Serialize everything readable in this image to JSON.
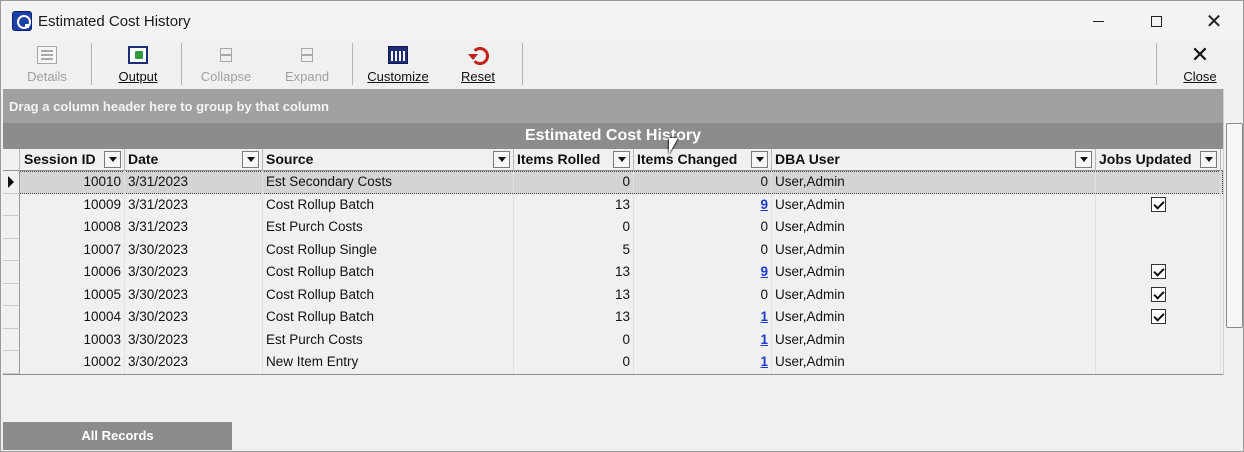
{
  "window": {
    "title": "Estimated Cost History"
  },
  "toolbar": {
    "details": "Details",
    "output": "Output",
    "collapse": "Collapse",
    "expand": "Expand",
    "customize": "Customize",
    "reset": "Reset",
    "close": "Close"
  },
  "grid": {
    "group_hint": "Drag a column header here to group by that column",
    "caption": "Estimated Cost History",
    "columns": [
      "Session ID",
      "Date",
      "Source",
      "Items Rolled",
      "Items Changed",
      "DBA User",
      "Jobs Updated"
    ],
    "rows": [
      {
        "session_id": "10010",
        "date": "3/31/2023",
        "source": "Est Secondary Costs",
        "items_rolled": "0",
        "items_changed": "0",
        "changed_link": false,
        "dba_user": "User,Admin",
        "jobs_updated": false,
        "active": true
      },
      {
        "session_id": "10009",
        "date": "3/31/2023",
        "source": "Cost Rollup Batch",
        "items_rolled": "13",
        "items_changed": "9",
        "changed_link": true,
        "dba_user": "User,Admin",
        "jobs_updated": true,
        "active": false
      },
      {
        "session_id": "10008",
        "date": "3/31/2023",
        "source": "Est Purch Costs",
        "items_rolled": "0",
        "items_changed": "0",
        "changed_link": false,
        "dba_user": "User,Admin",
        "jobs_updated": false,
        "active": false
      },
      {
        "session_id": "10007",
        "date": "3/30/2023",
        "source": "Cost Rollup Single",
        "items_rolled": "5",
        "items_changed": "0",
        "changed_link": false,
        "dba_user": "User,Admin",
        "jobs_updated": false,
        "active": false
      },
      {
        "session_id": "10006",
        "date": "3/30/2023",
        "source": "Cost Rollup Batch",
        "items_rolled": "13",
        "items_changed": "9",
        "changed_link": true,
        "dba_user": "User,Admin",
        "jobs_updated": true,
        "active": false
      },
      {
        "session_id": "10005",
        "date": "3/30/2023",
        "source": "Cost Rollup Batch",
        "items_rolled": "13",
        "items_changed": "0",
        "changed_link": false,
        "dba_user": "User,Admin",
        "jobs_updated": true,
        "active": false
      },
      {
        "session_id": "10004",
        "date": "3/30/2023",
        "source": "Cost Rollup Batch",
        "items_rolled": "13",
        "items_changed": "1",
        "changed_link": true,
        "dba_user": "User,Admin",
        "jobs_updated": true,
        "active": false
      },
      {
        "session_id": "10003",
        "date": "3/30/2023",
        "source": "Est Purch Costs",
        "items_rolled": "0",
        "items_changed": "1",
        "changed_link": true,
        "dba_user": "User,Admin",
        "jobs_updated": false,
        "active": false
      },
      {
        "session_id": "10002",
        "date": "3/30/2023",
        "source": "New Item Entry",
        "items_rolled": "0",
        "items_changed": "1",
        "changed_link": true,
        "dba_user": "User,Admin",
        "jobs_updated": false,
        "active": false
      }
    ]
  },
  "tabs": {
    "all_records": "All Records"
  }
}
